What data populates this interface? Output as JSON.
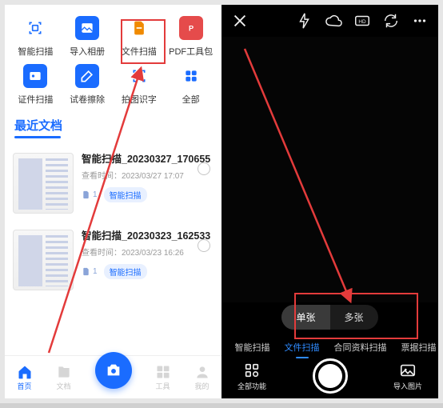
{
  "left": {
    "tools_row1": [
      {
        "id": "smart-scan",
        "label": "智能扫描",
        "color": "#1a6cff"
      },
      {
        "id": "import-album",
        "label": "导入相册",
        "color": "#1a6cff"
      },
      {
        "id": "file-scan",
        "label": "文件扫描",
        "color": "#f08a00",
        "highlighted": true
      },
      {
        "id": "pdf-tools",
        "label": "PDF工具包",
        "color": "#e54b4b"
      }
    ],
    "tools_row2": [
      {
        "id": "id-scan",
        "label": "证件扫描",
        "color": "#1a6cff"
      },
      {
        "id": "paper-erase",
        "label": "试卷擦除",
        "color": "#1a6cff"
      },
      {
        "id": "ocr",
        "label": "拍图识字",
        "color": "#1a6cff"
      },
      {
        "id": "all",
        "label": "全部",
        "color": "#1a6cff"
      }
    ],
    "section_title": "最近文档",
    "docs": [
      {
        "name": "智能扫描_20230327_170655",
        "time_label": "查看时间：",
        "time": "2023/03/27 17:07",
        "pages": "1",
        "tag": "智能扫描"
      },
      {
        "name": "智能扫描_20230323_162533",
        "time_label": "查看时间：",
        "time": "2023/03/23 16:26",
        "pages": "1",
        "tag": "智能扫描"
      }
    ],
    "bottom_nav": {
      "home": "首页",
      "files": "文档",
      "tools": "工具",
      "mine": "我的"
    }
  },
  "right": {
    "top_icons": [
      "close",
      "flash",
      "cloud",
      "hd",
      "refresh",
      "more"
    ],
    "mode_pill": {
      "single": "单张",
      "multi": "多张",
      "selected": "single"
    },
    "tabs": [
      {
        "id": "smart",
        "label": "智能扫描"
      },
      {
        "id": "file",
        "label": "文件扫描",
        "selected": true
      },
      {
        "id": "contract",
        "label": "合同资料扫描"
      },
      {
        "id": "ticket",
        "label": "票据扫描"
      }
    ],
    "bottom": {
      "all_fn": "全部功能",
      "import": "导入图片"
    }
  },
  "highlight_color": "#e33b3b"
}
